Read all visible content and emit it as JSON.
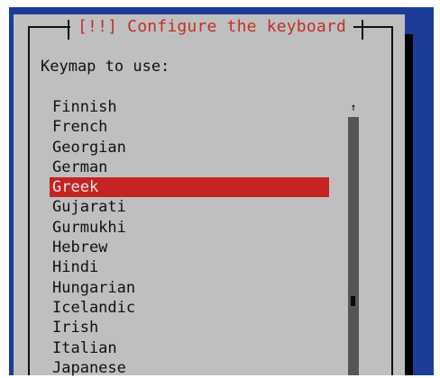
{
  "dialog": {
    "title": "[!!] Configure the keyboard",
    "prompt": "Keymap to use:"
  },
  "keymaps": [
    {
      "label": "Finnish"
    },
    {
      "label": "French"
    },
    {
      "label": "Georgian"
    },
    {
      "label": "German"
    },
    {
      "label": "Greek",
      "selected": true
    },
    {
      "label": "Gujarati"
    },
    {
      "label": "Gurmukhi"
    },
    {
      "label": "Hebrew"
    },
    {
      "label": "Hindi"
    },
    {
      "label": "Hungarian"
    },
    {
      "label": "Icelandic"
    },
    {
      "label": "Irish"
    },
    {
      "label": "Italian"
    },
    {
      "label": "Japanese"
    }
  ],
  "scrollbar": {
    "up_arrow_icon": "arrow-up-icon",
    "thumb_fraction": 0.72
  },
  "colors": {
    "background": "#1a3d9a",
    "dialog": "#bfbfbf",
    "title": "#c0302a",
    "selection": "#c42424"
  }
}
